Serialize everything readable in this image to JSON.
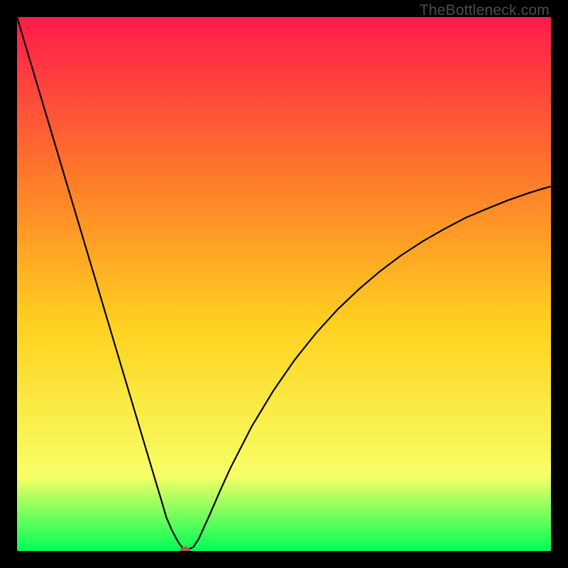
{
  "watermark": "TheBottleneck.com",
  "colors": {
    "frame": "#000000",
    "gradient_top": "#ff1a4a",
    "gradient_mid1": "#ff7a2a",
    "gradient_mid2": "#ffd21f",
    "gradient_mid3": "#f6ff66",
    "gradient_bottom": "#00ff55",
    "curve": "#000000",
    "marker": "#b95a47"
  },
  "chart_data": {
    "type": "line",
    "title": "",
    "xlabel": "",
    "ylabel": "",
    "xlim": [
      0,
      100
    ],
    "ylim": [
      0,
      100
    ],
    "series": [
      {
        "name": "bottleneck-curve",
        "x": [
          0,
          2,
          4,
          6,
          8,
          10,
          12,
          14,
          16,
          18,
          20,
          22,
          24,
          26,
          27,
          28,
          29,
          30,
          30.5,
          31,
          31.5,
          32,
          33,
          34,
          36,
          38,
          40,
          44,
          48,
          52,
          56,
          60,
          64,
          68,
          72,
          76,
          80,
          84,
          88,
          92,
          96,
          100
        ],
        "y": [
          100,
          93.3,
          86.6,
          79.9,
          73.2,
          66.5,
          59.8,
          53.1,
          46.4,
          39.7,
          33.0,
          26.3,
          19.6,
          12.9,
          9.6,
          6.2,
          3.9,
          2.0,
          1.2,
          0.6,
          0.3,
          0.3,
          0.7,
          2.2,
          6.6,
          11.2,
          15.6,
          23.4,
          30.0,
          35.8,
          40.8,
          45.2,
          49.0,
          52.4,
          55.4,
          58.0,
          60.3,
          62.4,
          64.1,
          65.7,
          67.1,
          68.3
        ]
      }
    ],
    "annotations": [
      {
        "name": "min-marker",
        "x": 31.5,
        "y": 0.15,
        "color": "#b95a47"
      }
    ]
  }
}
